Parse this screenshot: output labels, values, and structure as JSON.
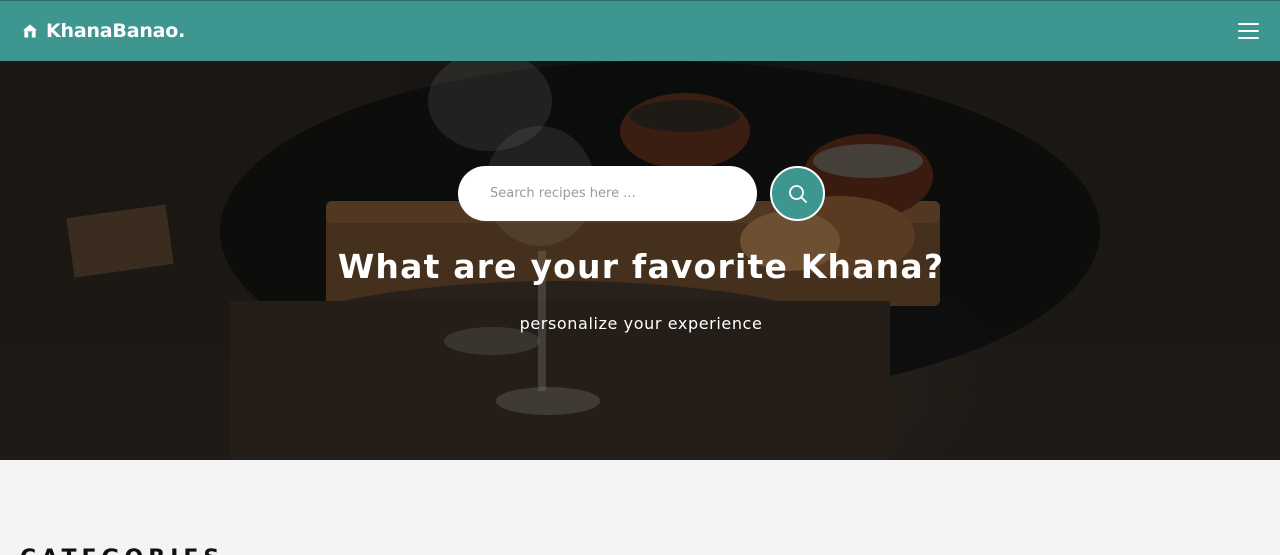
{
  "navbar": {
    "brand_name": "KhanaBanao.",
    "brand_icon": "home-icon",
    "menu_icon": "hamburger-menu-icon",
    "background_color": "#3d9690"
  },
  "hero": {
    "search": {
      "placeholder": "Search recipes here ...",
      "button_icon": "search-icon"
    },
    "title": "What are your favorite Khana?",
    "subtitle": "personalize your experience"
  },
  "categories": {
    "heading": "CATEGORIES"
  }
}
